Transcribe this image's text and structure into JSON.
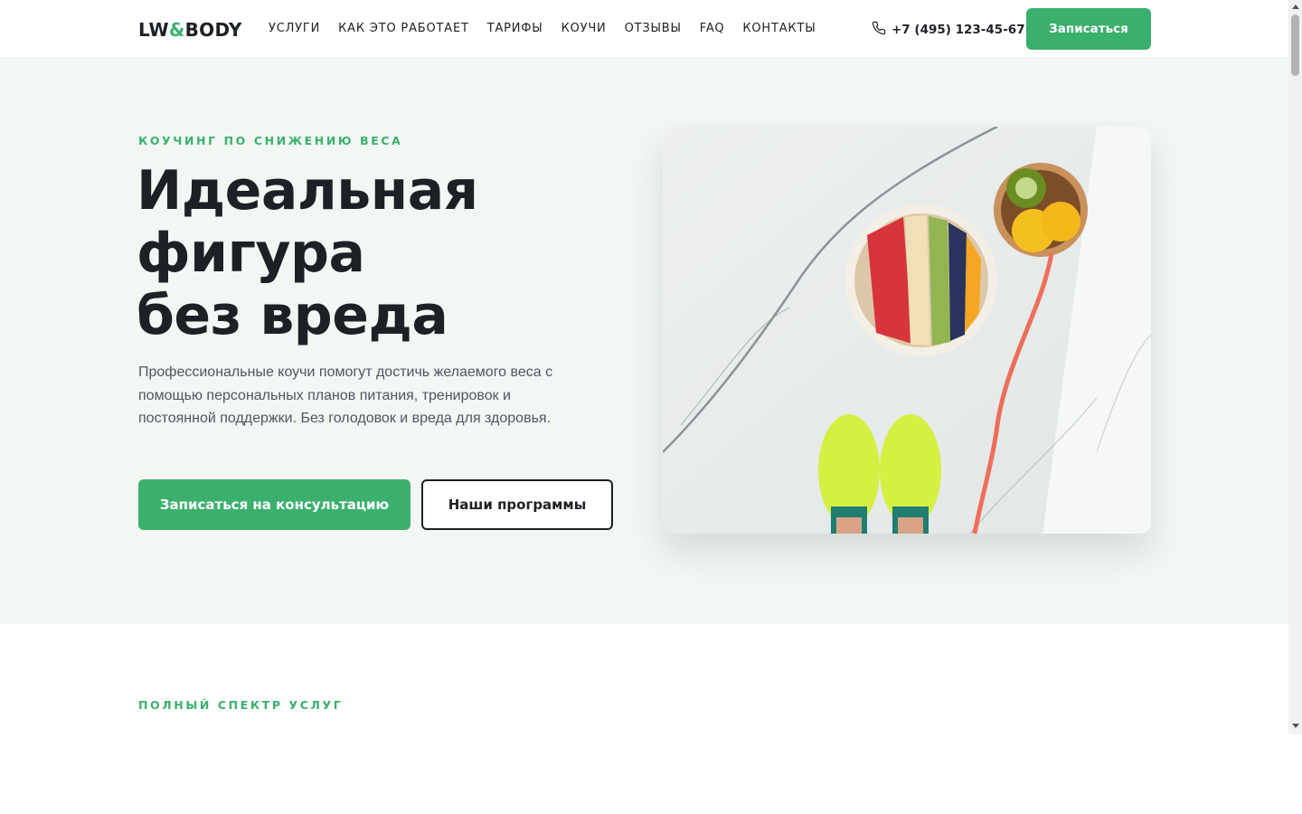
{
  "header": {
    "logo": {
      "left": "LW",
      "amp": "&",
      "right": "BODY"
    },
    "nav": [
      "Услуги",
      "Как это работает",
      "Тарифы",
      "Коучи",
      "Отзывы",
      "FAQ",
      "Контакты"
    ],
    "phone": "+7 (495) 123-45-67",
    "phone_icon": "phone-icon",
    "cta": "Записаться"
  },
  "hero": {
    "eyebrow": "Коучинг по снижению веса",
    "title_lines": [
      "Идеальная",
      "фигура",
      "без вреда"
    ],
    "lead": "Профессиональные коучи помогут достичь желаемого веса с помощью персональных планов питания, тренировок и постоянной поддержки. Без голодовок и вреда для здоровья.",
    "primary_button": "Записаться на консультацию",
    "secondary_button": "Наши программы"
  },
  "services": {
    "eyebrow": "Полный спектр услуг"
  },
  "colors": {
    "accent": "#3bb06d",
    "text": "#1d2024",
    "hero_bg": "#f2f7f4"
  }
}
